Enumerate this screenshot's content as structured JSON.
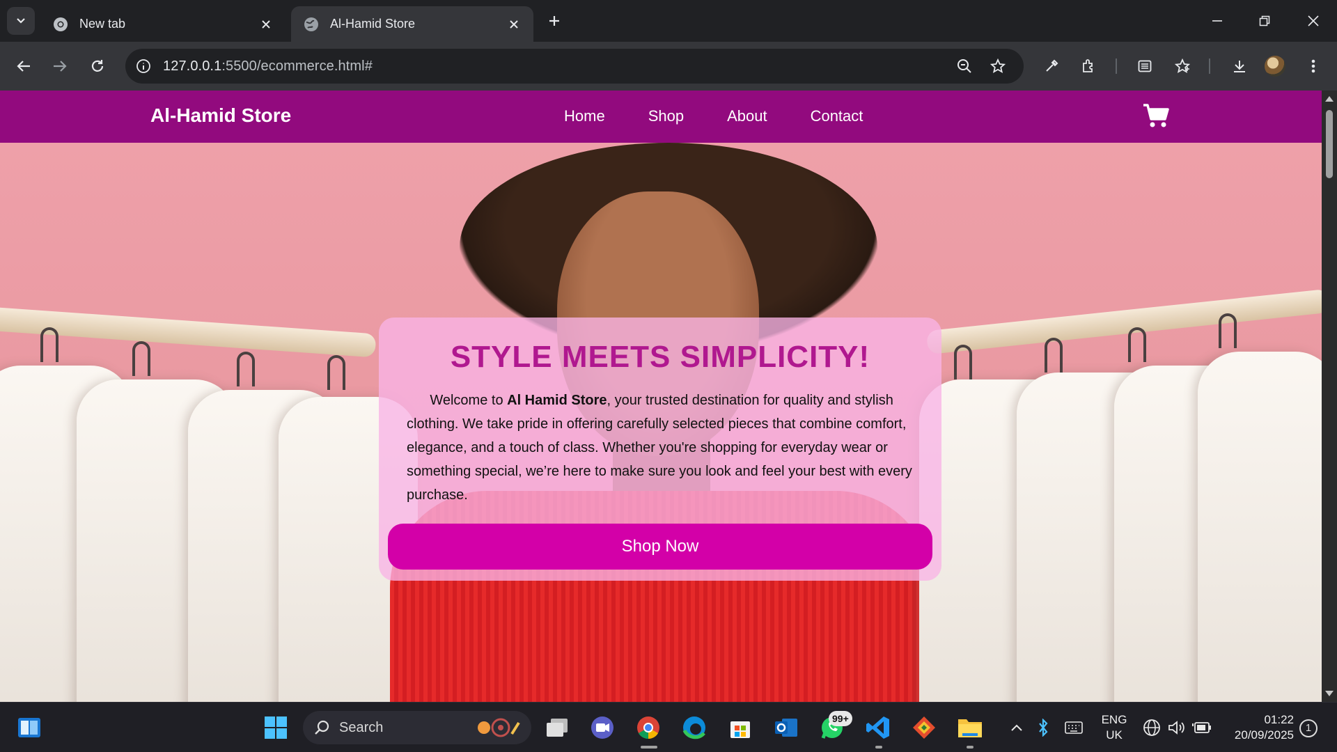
{
  "browser": {
    "tabs": [
      {
        "title": "New tab",
        "active": false
      },
      {
        "title": "Al-Hamid Store",
        "active": true
      }
    ],
    "url": {
      "host": "127.0.0.1",
      "rest": ":5500/ecommerce.html#"
    }
  },
  "site": {
    "brand": "Al-Hamid Store",
    "nav": [
      "Home",
      "Shop",
      "About",
      "Contact"
    ],
    "hero": {
      "heading": "STYLE MEETS SIMPLICITY!",
      "intro_pre": "Welcome to ",
      "intro_bold": "Al Hamid Store",
      "intro_post": ", your trusted destination for quality and stylish clothing. We take pride in offering carefully selected pieces that combine comfort, elegance, and a touch of class. Whether you're shopping for everyday wear or something special, we’re here to make sure you look and feel your best with every purchase.",
      "cta": "Shop Now"
    },
    "colors": {
      "nav_bg": "#920a7e",
      "heading": "#b0188f",
      "cta_bg": "#d300a8"
    }
  },
  "taskbar": {
    "search_label": "Search",
    "whatsapp_badge": "99+",
    "language": {
      "line1": "ENG",
      "line2": "UK"
    },
    "clock": {
      "time": "01:22",
      "date": "20/09/2025"
    },
    "notifications": "1"
  }
}
